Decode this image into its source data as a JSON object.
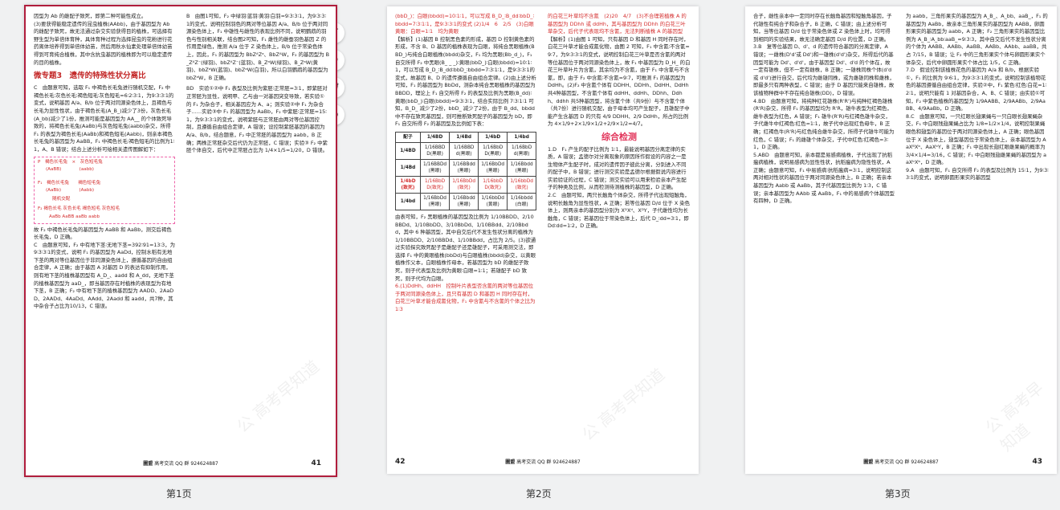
{
  "pages": [
    {
      "label": "第1页",
      "number": "41",
      "footer_brand": "圖盟",
      "footer_text": "高考交流 QQ 群 924624887",
      "left_paras": [
        "因型为 Ab 的雌配子致死，即第二种可能性成立。",
        "(3)要获得能稳定遗传的昆虫植株(AAbb)，由于基因型为 Ab 的雌配子致死，故无法通过杂交实验获得目的植株，可选择有野生型为单倍体育种，具体育种过程为选择昆虫的花粉进行花药离体培养得到单倍体幼苗，然后用秋水仙素处理单倍体幼苗得到可育纯合植株，其中含抗虫基因的植株即为可以稳定遗传的目的植株。"
      ],
      "section_title": "微专题3　遗传的特殊性状分离比",
      "left_q1": "C　由题意可知，选取 F₁ 中褐色长毛兔进行随机交配，F₂ 中褐色长毛∶灰色长毛∶褐色短毛∶灰色短毛=6∶2∶3∶1，为9∶3∶3∶1的变式，说明基因 A/a、B/b 位于两对同源染色体上，且褐色与长毛为显性性状，由于褐色长毛(A_B_)减少了3份，灰色长毛(A_bb)减少了1份，推测可能是基因型为 AA__ 的个体致死导致的，将褐色长毛兔(AaBb)与灰色短毛兔(aabb)杂交，所得 F₁ 的表型为褐色长毛(AaBb)和褐色短毛(Aabb)，则亲本褐色长毛兔的基因型为 AaBB，F₁ 中褐色长毛∶褐色短毛的比例为1∶1，A、B 错误；结合上述分析可绘相关遗传图解如下：",
      "diagram": {
        "p": "P　褐色长毛兔　×　灰色短毛兔",
        "p_geno": "(AaBB)　　　　(aabb)",
        "f1": "F₁　褐色长毛兔　　褐色短毛兔",
        "f1_geno": "(AaBb)　　　　(Aabb)",
        "cross": "随机交配",
        "f2": "F₂ 褐色长毛 灰色长毛 褐色短毛 灰色短毛",
        "f2_geno": "AaBb AaBB aaBb aabb"
      },
      "left_tail": "故 F₂ 中褐色长毛兔的基因型为 AaBB 和 AaBb，测交后褐色长毛兔，D 正确。",
      "left_q2": "C　由题意可知，F₂ 中有地下茎∶无地下茎=392∶91=13∶3，为9∶3∶3∶1的变式，说明 F₁ 的基因型为 AaDd，控制水稻有无地下茎的两对等位基因位于非同源染色体上，遵循基因的自由组合定律，A 正确；由于基因 A 对基因 D 的表达有抑制作用，则有地下茎的植株基因型有 A_D_、aadd 和 A_dd，无地下茎的植株基因型为 aaD_，即当基因存在时植株的表现型为有地下茎，B 正确；F₂ 中有地下茎的植株基因型为 AADD、2AaDD、2AADd、4AaDd、AAdd、2Aadd 和 aadd，共7种，其中杂合子占比为10/13，C 错误。",
      "right_q3": "B　由图1可知，F₂ 中绿羽∶蓝羽∶黄羽∶白羽=9∶3∶3∶1，为9∶3∶3∶1的变式，说明控制羽色的两对等位基因 A/a、B/b 位于两对同源染色体上，F₁ 中雄性与雌性的表现比例不同，说明鹦鹉的羽色与性别相关联，结合图2可知，F₁ 雌性的雌蚕羽色基因 Z 的作用是绿色，推测 A/a 位于 Z 染色体上，B/b 位于常染色体上，因此，F₁ 的基因型为 BbZᴬZᵃ、BbZᴬW，F₂ 的基因型为 B_ZᴬZ⁻(绿羽)、bbZᴬZ⁻(蓝羽)、B_ZᵃW(绿羽)、B_ZᵃW(黄羽)、bbZᵃW(蓝羽)、bbZᵃW(白羽)，所以白羽鹦鹉的基因型为 bbZᵃW，B 正确。",
      "right_q4": "BD　实验①②中 F₁ 表型及比例为紫胚∶正常胚=3∶1，即紫胚对正常胚为显性，说明甲、乙与由一对基因突变导致，若实验①的 F₁ 为杂合子，相关基因应为 A、a；则实验②中 F₁ 为杂合子……实验③中 F₁ 的基因型为 AaBb，F₂ 中紫胚∶正常胚=15∶1，为9∶3∶3∶1的变式，说明紫胚与正常胚由两对等位基因控制，且遵循自由组合定律，A 错误；设控制紫胚基因的基因为 A/a、B/b，结合题意，F₂ 中正常胚的基因型为 aabb，B 正确；两株正常胚杂交后代仍为正常胚，C 错误；实验③ F₂ 中紫胚个体自交，后代中正常胚占比为 1/4×1/5=1/20，D 错误。"
    },
    {
      "label": "第2页",
      "number": "42",
      "footer_brand": "圖盟",
      "footer_text": "高考交流 QQ 群 924624887",
      "left_intro": "(bbD_)：白眼(bbdd)=10∶1∶1，可以写成 B_D_∶B_dd∶bbD_∶bbdd=7∶3∶1∶1，是9∶3∶3∶1的变式 (2)1/4　6　2/5　(3)白眼　黄眼：白眼=1∶1　均为黄眼",
      "left_analysis": "【解析】(1)基因 B 控制黑色素的形成，基因 D 控制黄色素的形成，不含 B、D 基因的植株表现为白眼，将纯合黑眼植株(BBD_)与纯合白眼植株(bbdd)杂交，F₁ 均为黑眼(Bb_d_)，F₁ 自交所得 F₂ 中黑眼(B_ _ _)∶黄眼(bbD_)∶白眼(bbdd)=10∶1∶1，可以写成 B_D_∶B_dd∶bbD_∶bbdd=7∶3∶1∶1，是9∶3∶3∶1的变式，故基因 B、D 的遗传遵循自由组合定律。(2)由上述分析可知，F₁ 的基因型为 BbDd，测杂本纯合黑眼植株的基因型为 BBDD，理论上 F₁ 自交所得 F₂ 的表型及比例为黑眼(B_dd)∶黄眼(bbD_)∶白眼(bbdd)=9∶3∶3∶1，结合实际比例 7∶3∶1∶1 可知，B_D_ 减少了2份，bbD_ 减少了2份，由于 B_dd、bbdd 中不存在致死基因型，则可推断致死配子的基因型为 bD，即 F₁ 自交所得 F₂ 的基因型及比例如下表：",
      "table": {
        "corner": "配子",
        "cols": [
          "1/4BD",
          "1/4Bd",
          "1/4bD",
          "1/4bd"
        ],
        "rows": [
          {
            "head": "1/4BD",
            "cells": [
              "1/16BBDD(黑眼)",
              "1/16BBDd(黑眼)",
              "1/16BbDD(黑眼)",
              "1/16BbDd(黑眼)"
            ]
          },
          {
            "head": "1/4Bd",
            "cells": [
              "1/16BBDd(黑眼)",
              "1/16BBdd(黑眼)",
              "1/16BbDd(黑眼)",
              "1/16Bbdd(黑眼)"
            ]
          },
          {
            "head": "1/4bD(致死)",
            "cells": [
              "1/16BbDD(致死)",
              "1/16BbDd(致死)",
              "1/16bbDD(致死)",
              "1/16bbDd(致死)"
            ]
          },
          {
            "head": "1/4bd",
            "cells": [
              "1/16BbDd(黑眼)",
              "1/16Bbdd(黑眼)",
              "1/16bbDd(黄眼)",
              "1/16bbdd(白眼)"
            ]
          }
        ]
      },
      "left_after_table": "由表可知，F₂ 黑眼植株的基因型及比例为 1/10BBDD、2/10BBDd、1/10BbDD、3/10BbDd、1/10BBdd、2/10Bbdd，其中 6 种基因型，其中自交后代不发生性状分离的植株为 1/10BBDD、2/10BBDd、1/10BBdd，占比为 2/5。(3)欲通过实验探究致死配子是雌配子还是雄配子，可采用测交法，即选择 F₁ 中的黄眼植株(bbDd)与白眼植株(bbdd)杂交，以黄眼植株作父本，白眼植株作母本，若基因型为 bD 的雌配子致死，则子代表型及比例为黄眼∶白眼=1∶1；若雄配子 bD 致死，则子代均为白眼。",
      "left_q6": "6.(1)DdHh、ddHH　控制叶片表型否含氰的两对等位基因位于两对同源染色体上，且只有基因 D 和基因 H 同时存在时，白花三叶草才能合成氰化物，F₁ 中含氰与不含氰的个体之比为 1∶3",
      "right_top": "的白花三叶草均不含氰　(2)20　4/7　(3)不合理若植株 A 的基因型为 DDhh 或 ddHh，其与基因型为 DDhh 的白花三叶草杂交，后代子代表现均不含氰，无法判断植株 A 的基因型",
      "right_analysis": "【解析】(1)由图 1 可知，只有基因 D 和基因 H 同时存在时，白花三叶草才能合成氰化物，由图 2 可知，F₁ 中含氰∶不含氰=9∶7，为9∶3∶3∶1的变式，说明控制白花三叶草是否含氰的两对等位基因位于两对同源染色体上，故 F₁ 中基因型为 D_H_ 的白花三叶草叶片为含氰，其余均为不含氰，由于 F₁ 中含氰与不含氰，即，由于 F₂ 中含氰∶不含氰=9∶7，可推测 F₁ 的基因型为 DdHh。(2)F₂ 中含氰个体有 DDHH、DDHh、DdHH、DdHh 共4种基因型，不含氰个体有 ddHH、ddHh、DDhh、Ddhh、ddhh 共5种基因型，将含氰个体（共9份）与不含氰个体（共7份）进行随机交配，由于母本均可产生配子，且雄配子中能产生含基因 D 的只有 4/9 DDHH、2/9 DdHh，所占的比例为 4×1/9+2×1/9×1/2+2/9×1/2=4/7。",
      "section_title": "综合检测",
      "right_q1": "1.D　F₁ 产生的配子比例为 1∶1，最能说明基因分离定律的实质，A 错误；孟德尔对分离现象的原因所作假设的内容之一是生物体产生配子时，成对的遗传因子彼此分离，分别进入不同的配子中，B 错误；进行测交实验是孟德尔根据假说内容进行实验验证的过程，C 错误；测交实验可以用来检验亲本产生配子的种类及比例，从而检测待测植株的基因型，D 正确。",
      "right_q2": "2.C　由题可知，两只长触角个体杂交，所得子代出现短触角，说明长触角为显性性状，A 正确；若等位基因 D/d 位于 X 染色体上，则两亲本的基因型分别为 XᴰXᵈ、XᴰY，子代雌性均为长触角，C 错误；若基因位于常染色体上，后代 D_∶dd=3∶1，即 Dd∶dd=1∶2，D 正确。"
    },
    {
      "label": "第3页",
      "number": "43",
      "footer_brand": "圖盟",
      "footer_text": "高考交流 QQ 群 924624887",
      "left_text": "合子，雌性亲本中一定同时存在长触角基因和短触角基因，子代雄性有纯合子和杂合子，B 正确，C 错误；由上述分析可知，当等位基因 D/d 位于常染色体或 Z 染色体上时，均可得到相同的实验结果，故无法确定基因 D/d 的位置，D 正确。",
      "left_q3": "3.B　复等位基因 D、d'、d 的遗传符合基因的分离定律，A 错误；一雌株(D'd'或 Dd')和一雄株(d'd')杂交，所得后代的基因型可能为 Dd'、d'd'，由于基因型 Dd'、d'd 的个体在，故一定有雄株，但不一定有雌株，B 正确；一雄株同株个体(d'd 或 d'd')进行自交，后代均为雌雄同株，或为雌雄同株和雌株，即最多只有两种表型，C 错误；由于 D 基因只能来自雄株，故该植物种群中不存在纯合雄株(DD)，D 错误。",
      "left_q4": "4.BD　由题意可知，将纯种红花雄株(R'R')与纯种红褐色雄株(R'R)杂交，所得 F₁ 的基因型均为 R'R，雄牛表型为红褐色，雌牛表型为红色，A 错误；F₁ 雄牛(R'R)与红褐色雄牛杂交，子代雌牛中红褐色∶红色=1∶1，故子代中出现红色母牛，B 正确；红褐色牛(R'R)与红色纯合雌牛杂交，所得子代雄牛可能为红色，C 错误；F₁ 的雌雄个体杂交，子代中红色∶红褐色=3∶1，D 正确。",
      "left_q5": "5.ABD　由题意可知，亲本都是易感病植株，子代出现了抗稻瘟病植株，说明易感病为显性性状，抗稻瘟病为隐性性状，A 正确；由题意可知，F₁ 中易感病∶抗稻瘟病=3∶1，说明控制这两对相对性状的基因位于两对同源染色体上，B 正确；若亲本基因型为 Aabb 或 AaBb，其子代基因型比例为 1∶3，C 错误；亲本基因型为 AAbb 或 AaBb，F₁ 中的易感病个体基因型有四种，D 正确。",
      "right_text": "为 aabb，三角形果实的基因型为 A_B_、A_bb、aaB_，F₁ 的基因型为 AaBb，故亲本三角形果实的基因型为 AABB，卵圆形果实的基因型为 aabb，A 正确；F₂ 三角形果实的基因型比例为 A_B_∶A_bb∶aaB_=9∶3∶3，其中自交后代不发生性状分离的个体为 AABB、AABb、AaBB、AABb、AAbb、aaBB，共占 7/15，B 错误；让 F₂ 中的三角形果实个体与卵圆形果实个体杂交，后代中卵圆形果实个体占比 1/5，C 正确。",
      "right_q7": "7.D　假设控制该植株花色的基因为 A/a 和 B/b，根据实验①，F₁ 的比例为 9∶6∶1，为9∶3∶3∶1的变式，说明控制该植物花色的基因遵循自由组合定律，实验②中，F₁ 紫色∶红色∶白花=1∶2∶1，说明只能有 1 对基因杂合，A、B、C 错误；由实验①可知，F₂ 中紫色植株的基因型为 1/9AABB、2/9AABb、2/9AaBB、4/9AaBb，D 正确。",
      "right_q8": "8.C　由题意可知，一只红眼长翅果蝇与一只白眼长翅果蝇杂交，F₁ 中白眼残翅果蝇占比为 1/8=1/2×1/4，说明控制果蝇眼色和翅型的基因位于两对同源染色体上，A 正确；眼色基因位于 X 染色体上，翅型基因位于常染色体上，亲本基因型为 AaXᴮXᵇ、AaXᵇY，B 正确；F₁ 中出现长翅红眼雌果蝇的概率为 3/4×1/4=3/16，C 错误；F₁ 中白眼残翅雌果蝇的基因型为 aaXᵇXᵇ，D 正确。",
      "right_q9": "9.A　由题可知，F₁ 自交所得 F₂ 的表型及比例为 15∶1，为9∶3∶3∶1的变式，说明卵圆形果实的基因型"
    }
  ],
  "toolbar": {
    "rotate_left": "↺",
    "rotate_right": "↻",
    "delete": "🗑",
    "add": "⊕"
  },
  "watermark": "公 高考早知道"
}
